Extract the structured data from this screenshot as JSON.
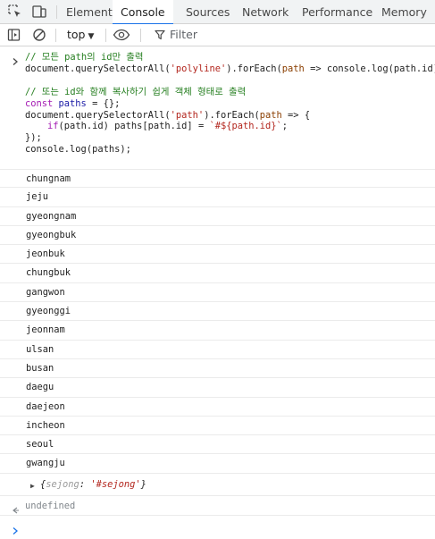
{
  "tabs": [
    {
      "label": "Elements",
      "active": false
    },
    {
      "label": "Console",
      "active": true
    },
    {
      "label": "Sources",
      "active": false
    },
    {
      "label": "Network",
      "active": false
    },
    {
      "label": "Performance",
      "active": false
    },
    {
      "label": "Memory",
      "active": false
    }
  ],
  "toolbar": {
    "context": "top",
    "filter_placeholder": "Filter"
  },
  "input_code": {
    "l1_comment": "// 모든 path의 id만 출력",
    "l2_a": "document.querySelectorAll(",
    "l2_str": "'polyline'",
    "l2_b": ").forEach(",
    "l2_param": "path",
    "l2_c": " => console.log(path.id));",
    "l3_comment": "// 또는 id와 함께 복사하기 쉽게 객체 형태로 출력",
    "l4_kw": "const",
    "l4_var": " paths",
    "l4_rest": " = {};",
    "l5_a": "document.querySelectorAll(",
    "l5_str": "'path'",
    "l5_b": ").forEach(",
    "l5_param": "path",
    "l5_c": " => {",
    "l6_indent": "    ",
    "l6_kw": "if",
    "l6_a": "(path.id) paths[path.id] = ",
    "l6_tpl": "`#${path.id}`",
    "l6_b": ";",
    "l7": "});",
    "l8": "console.log(paths);"
  },
  "logs": [
    "chungnam",
    "jeju",
    "gyeongnam",
    "gyeongbuk",
    "jeonbuk",
    "chungbuk",
    "gangwon",
    "gyeonggi",
    "jeonnam",
    "ulsan",
    "busan",
    "daegu",
    "daejeon",
    "incheon",
    "seoul",
    "gwangju"
  ],
  "object_output": {
    "open": "{",
    "key": "sejong",
    "sep": ": ",
    "value": "'#sejong'",
    "close": "}"
  },
  "result": "undefined",
  "colors": {
    "accent": "#1a73e8",
    "comment": "#267f20",
    "keyword": "#a41ab3",
    "string": "#b3261e"
  },
  "icons": [
    "inspect-element-icon",
    "device-toolbar-icon",
    "sidebar-toggle-icon",
    "clear-console-icon",
    "eye-icon",
    "filter-icon",
    "chevron-right-icon",
    "return-arrow-icon"
  ]
}
